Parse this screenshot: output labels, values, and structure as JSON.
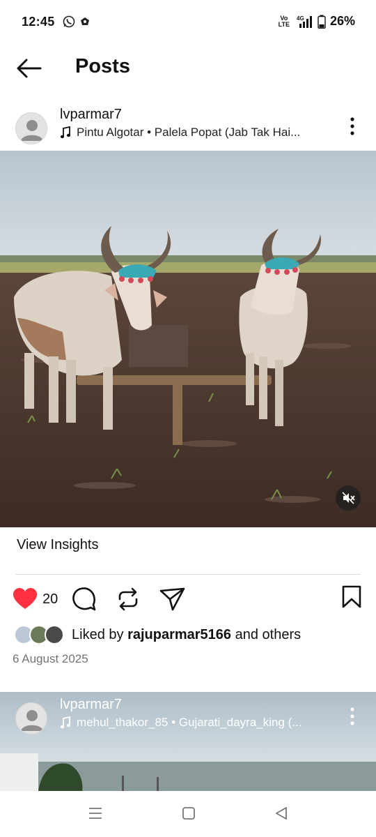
{
  "status_bar": {
    "time": "12:45",
    "battery": "26%",
    "volte_line1": "Vo",
    "volte_line2": "LTE",
    "network": "4G"
  },
  "header": {
    "title": "Posts",
    "back_icon": "arrow-left-icon"
  },
  "posts": [
    {
      "username": "lvparmar7",
      "music": "Pintu Algotar • Palela Popat (Jab Tak Hai...",
      "insights_label": "View Insights",
      "like_count": "20",
      "liked_by_prefix": "Liked by ",
      "liked_by_user": "raju​parmar5166",
      "liked_by_suffix": " and others",
      "date": "6 August 2025"
    },
    {
      "username": "lvparmar7",
      "music": "mehul_thakor_85 • Gujarati_dayra_king (..."
    }
  ],
  "colors": {
    "like_red": "#ff3040",
    "text": "#111111",
    "muted": "#737373",
    "divider": "#dbdbdb"
  },
  "icons": [
    "whatsapp-icon",
    "shield-icon",
    "signal-icon",
    "battery-icon",
    "music-note-icon",
    "more-vertical-icon",
    "muted-speaker-icon",
    "heart-icon",
    "comment-icon",
    "repost-icon",
    "share-icon",
    "bookmark-icon",
    "menu-icon",
    "home-square-icon",
    "back-triangle-icon"
  ]
}
